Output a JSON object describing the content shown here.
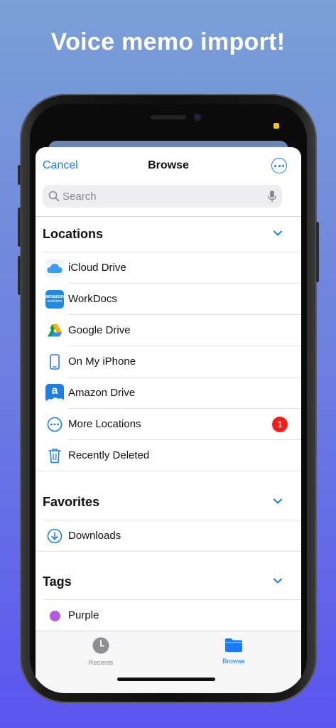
{
  "headline": "Voice memo import!",
  "nav": {
    "cancel": "Cancel",
    "title": "Browse"
  },
  "search": {
    "placeholder": "Search"
  },
  "sections": {
    "locations": "Locations",
    "favorites": "Favorites",
    "tags": "Tags"
  },
  "locations": [
    {
      "label": "iCloud Drive",
      "icon": "icloud-icon"
    },
    {
      "label": "WorkDocs",
      "icon": "workdocs-icon"
    },
    {
      "label": "Google Drive",
      "icon": "google-drive-icon"
    },
    {
      "label": "On My iPhone",
      "icon": "iphone-icon"
    },
    {
      "label": "Amazon Drive",
      "icon": "amazon-drive-icon"
    },
    {
      "label": "More Locations",
      "icon": "ellipsis-circle-icon",
      "badge": "1"
    },
    {
      "label": "Recently Deleted",
      "icon": "trash-icon"
    }
  ],
  "favorites": [
    {
      "label": "Downloads",
      "icon": "download-circle-icon"
    }
  ],
  "tags": [
    {
      "label": "Purple",
      "color": "#b25bdc"
    }
  ],
  "tabbar": {
    "recents": "Recents",
    "browse": "Browse"
  },
  "colors": {
    "accent": "#1a7cf5",
    "badge": "#ff1a1a",
    "inactive_tab": "#8e8e93"
  }
}
